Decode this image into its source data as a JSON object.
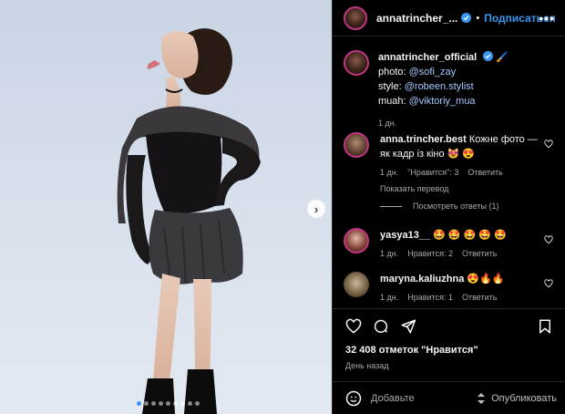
{
  "post": {
    "username": "annatrincher_...",
    "follow_label": "Подписаться",
    "separator": "•",
    "more": "•••",
    "carousel_next": "›",
    "slide_count": 9,
    "active_slide": 0
  },
  "caption": {
    "username": "annatrincher_official",
    "emoji": "🖌️",
    "lines": [
      {
        "prefix": "photo: ",
        "link": "@sofi_zay"
      },
      {
        "prefix": "style: ",
        "link": "@robeen.stylist"
      },
      {
        "prefix": "muah: ",
        "link": "@viktoriy_mua"
      }
    ],
    "time": "1 дн."
  },
  "comments": [
    {
      "username": "anna.trincher.best",
      "text": "Кожне фото — як кадр із кіно 😻 😍",
      "time": "1 дн.",
      "likes": "\"Нравится\": 3",
      "reply": "Ответить",
      "translate": "Показать перевод"
    },
    {
      "username": "yasya13__",
      "text": "🤩 🤩 🤩 🤩 🤩",
      "time": "1 дн.",
      "likes": "Нравится: 2",
      "reply": "Ответить"
    },
    {
      "username": "maryna.kaliuzhna",
      "text": "😍🔥🔥",
      "time": "1 дн.",
      "likes": "Нравится: 1",
      "reply": "Ответить"
    }
  ],
  "view_replies": "Посмотреть ответы (1)",
  "stats": {
    "likes": "32 408 отметок \"Нравится\"",
    "date": "День назад"
  },
  "composer": {
    "placeholder": "Добавьте",
    "publish": "Опубликовать"
  },
  "icons": {
    "verified": "verified-badge-icon",
    "heart": "heart-icon",
    "comment": "comment-icon",
    "share": "share-icon",
    "bookmark": "bookmark-icon",
    "emoji": "emoji-icon"
  }
}
